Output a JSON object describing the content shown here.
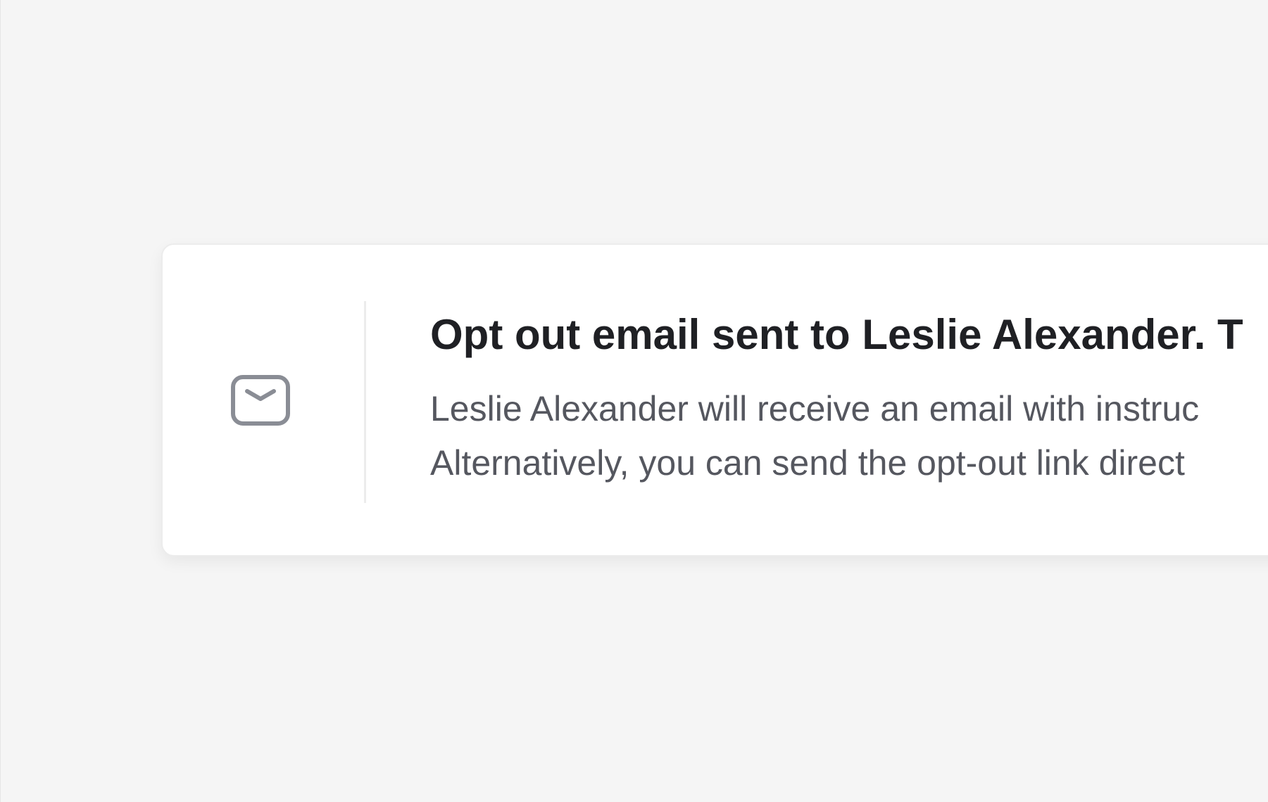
{
  "toast": {
    "icon": "mail-icon",
    "title": "Opt out email sent to Leslie Alexander. T",
    "body_lines": [
      "Leslie Alexander will receive an email with instruc",
      "Alternatively, you can send the opt-out link direct"
    ]
  },
  "colors": {
    "background": "#f5f5f5",
    "card": "#ffffff",
    "title": "#1f2024",
    "body": "#55575f",
    "icon": "#8a8d95",
    "divider": "#ececec"
  }
}
